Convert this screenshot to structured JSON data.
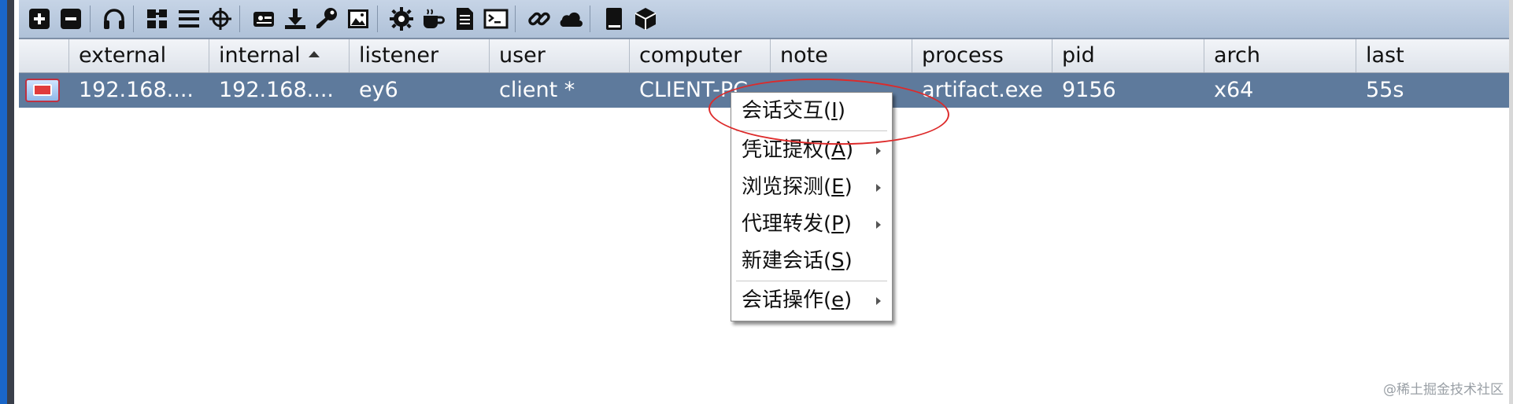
{
  "toolbar": {
    "buttons": [
      {
        "icon": "plus-square-icon"
      },
      {
        "icon": "minus-square-icon"
      },
      {
        "icon": "headphones-icon"
      },
      {
        "icon": "network-graph-icon"
      },
      {
        "icon": "list-icon"
      },
      {
        "icon": "crosshair-icon"
      },
      {
        "icon": "screenshot-icon"
      },
      {
        "icon": "download-icon"
      },
      {
        "icon": "key-icon"
      },
      {
        "icon": "image-icon"
      },
      {
        "icon": "gear-icon"
      },
      {
        "icon": "coffee-cup-icon"
      },
      {
        "icon": "document-icon"
      },
      {
        "icon": "terminal-icon"
      },
      {
        "icon": "link-icon"
      },
      {
        "icon": "cloud-icon"
      },
      {
        "icon": "book-icon"
      },
      {
        "icon": "package-icon"
      }
    ]
  },
  "table": {
    "columns": [
      "external",
      "internal",
      "listener",
      "user",
      "computer",
      "note",
      "process",
      "pid",
      "arch",
      "last"
    ],
    "sorted_column": "internal",
    "rows": [
      {
        "external": "192.168....",
        "internal": "192.168....",
        "listener": "ey6",
        "user": "client *",
        "computer": "CLIENT-PC",
        "note": "",
        "process": "artifact.exe",
        "pid": "9156",
        "arch": "x64",
        "last": "55s"
      }
    ]
  },
  "context_menu": {
    "items": [
      {
        "label": "会话交互(",
        "mnemonic": "I",
        "suffix": ")",
        "submenu": false
      },
      {
        "label": "凭证提权(",
        "mnemonic": "A",
        "suffix": ")",
        "submenu": true
      },
      {
        "label": "浏览探测(",
        "mnemonic": "E",
        "suffix": ")",
        "submenu": true
      },
      {
        "label": "代理转发(",
        "mnemonic": "P",
        "suffix": ")",
        "submenu": true
      },
      {
        "label": "新建会话(",
        "mnemonic": "S",
        "suffix": ")",
        "submenu": false
      },
      {
        "label": "会话操作(",
        "mnemonic": "e",
        "suffix": ")",
        "submenu": true
      }
    ]
  },
  "watermark": "@稀土掘金技术社区",
  "colors": {
    "selected_row": "#5e7a9c",
    "annotation": "#dd2a2a",
    "toolbar": "#b8c8dc"
  }
}
